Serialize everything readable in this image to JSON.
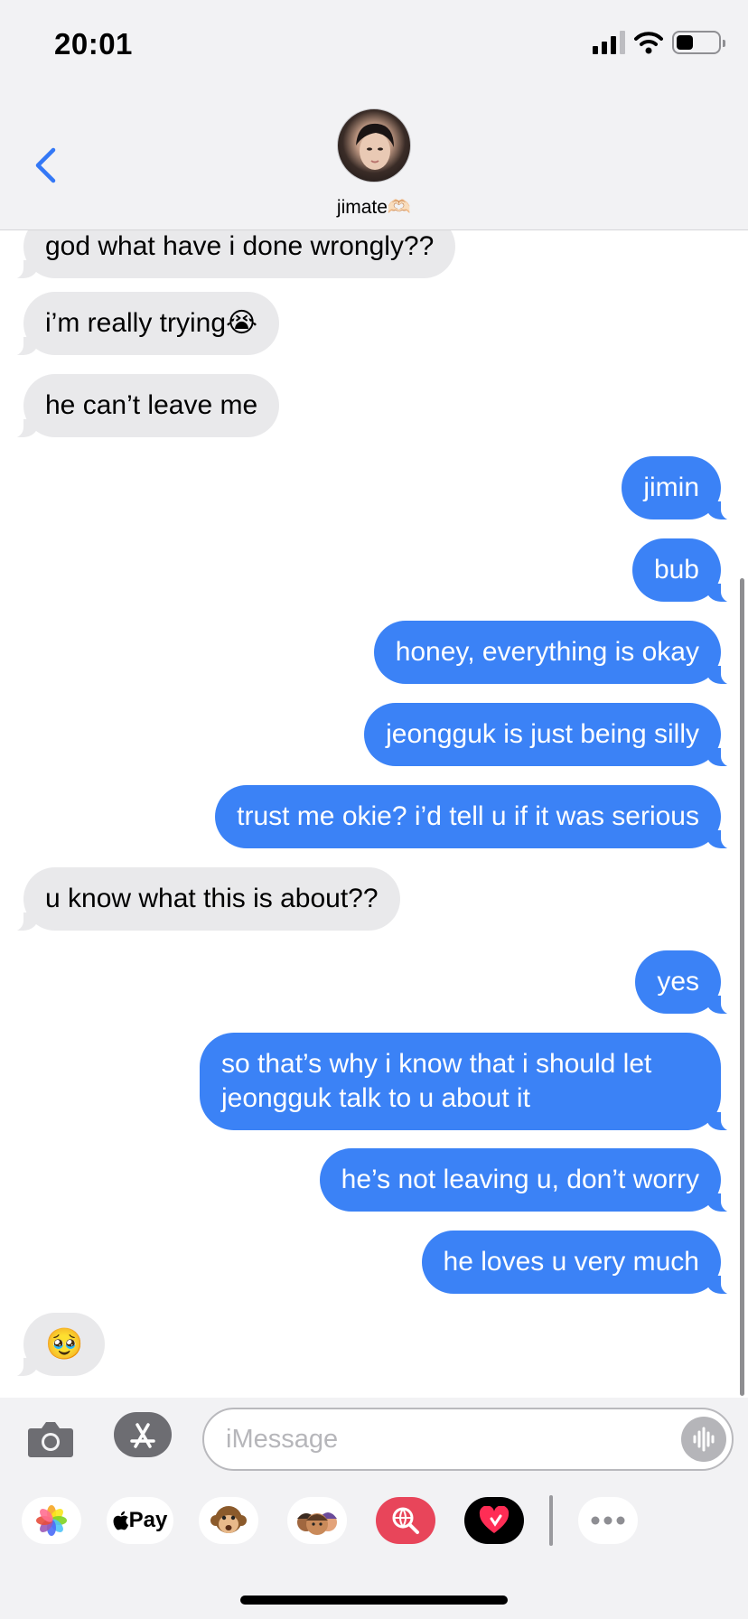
{
  "status_bar": {
    "time": "20:01",
    "battery_level": 0.4,
    "signal_bars": 3
  },
  "header": {
    "contact_name": "jimate🫶🏻",
    "back_icon": "chevron-left-icon",
    "avatar": "contact-avatar"
  },
  "messages": [
    {
      "from": "them",
      "text": "god what have i done wrongly??"
    },
    {
      "from": "them",
      "text": "i’m really trying😭"
    },
    {
      "from": "them",
      "text": "he can’t leave me"
    },
    {
      "from": "me",
      "text": "jimin"
    },
    {
      "from": "me",
      "text": "bub"
    },
    {
      "from": "me",
      "text": "honey, everything is okay"
    },
    {
      "from": "me",
      "text": "jeongguk is just being silly"
    },
    {
      "from": "me",
      "text": "trust me okie? i’d tell u if it was serious"
    },
    {
      "from": "them",
      "text": "u know what this is about??"
    },
    {
      "from": "me",
      "text": "yes"
    },
    {
      "from": "me",
      "text": "so that’s why i know that i should let jeongguk talk to u about it"
    },
    {
      "from": "me",
      "text": "he’s not leaving u, don’t worry"
    },
    {
      "from": "me",
      "text": "he loves u very much"
    },
    {
      "from": "them",
      "text": "🥹"
    }
  ],
  "input": {
    "placeholder": "iMessage",
    "camera_icon": "camera-icon",
    "apps_icon": "app-store-icon",
    "audio_icon": "audio-waveform-icon"
  },
  "drawer": {
    "apps": [
      {
        "name": "photos-app-icon"
      },
      {
        "name": "apple-pay-app-icon",
        "label": "Pay"
      },
      {
        "name": "animoji-app-icon"
      },
      {
        "name": "memoji-app-icon"
      },
      {
        "name": "image-search-app-icon"
      },
      {
        "name": "digital-touch-app-icon"
      },
      {
        "name": "more-apps-icon"
      }
    ]
  },
  "colors": {
    "outgoing_bubble": "#3b82f6",
    "incoming_bubble": "#e9e9eb",
    "accent": "#3478f6"
  }
}
